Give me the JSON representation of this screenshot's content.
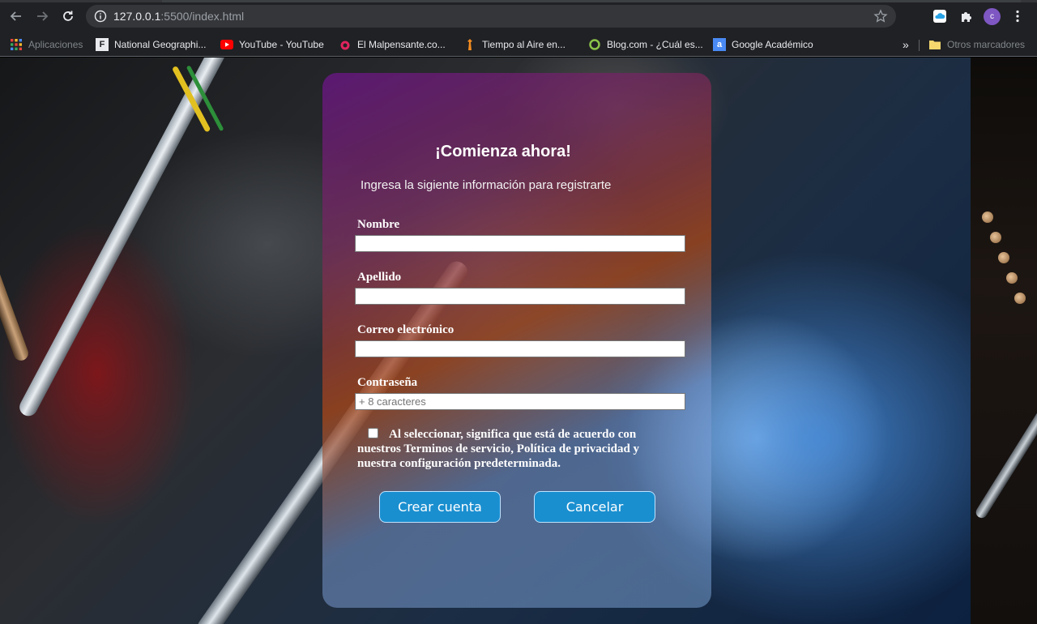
{
  "browser": {
    "url_host": "127.0.0.1",
    "url_rest": ":5500/index.html",
    "profile_initial": "c",
    "bookmarks": [
      {
        "label": "Aplicaciones",
        "icon": "apps-grid-icon"
      },
      {
        "label": "National Geographi...",
        "icon": "national-geographic-icon"
      },
      {
        "label": "YouTube - YouTube",
        "icon": "youtube-icon"
      },
      {
        "label": "El Malpensante.co...",
        "icon": "malpensante-icon"
      },
      {
        "label": "Tiempo al Aire en...",
        "icon": "tiempo-al-aire-icon"
      },
      {
        "label": "Blog.com - ¿Cuál es...",
        "icon": "blog-icon"
      },
      {
        "label": "Google Académico",
        "icon": "google-scholar-icon"
      }
    ],
    "overflow_label": "»",
    "other_bookmarks": "Otros marcadores"
  },
  "form": {
    "title": "¡Comienza ahora!",
    "subtitle": "Ingresa la sigiente información para registrarte",
    "fields": [
      {
        "label": "Nombre",
        "value": "",
        "placeholder": ""
      },
      {
        "label": "Apellido",
        "value": "",
        "placeholder": ""
      },
      {
        "label": "Correo electrónico",
        "value": "",
        "placeholder": ""
      },
      {
        "label": "Contraseña",
        "value": "",
        "placeholder": "+ 8 caracteres"
      }
    ],
    "terms_text": "Al seleccionar, significa que está de acuerdo con nuestros Terminos de servicio, Política de privacidad y nuestra configuración predeterminada.",
    "terms_checked": false,
    "create_button": "Crear cuenta",
    "cancel_button": "Cancelar"
  },
  "colors": {
    "button_bg": "#1a8fd0",
    "chrome_bg": "#202124",
    "avatar_bg": "#7e57c2"
  }
}
